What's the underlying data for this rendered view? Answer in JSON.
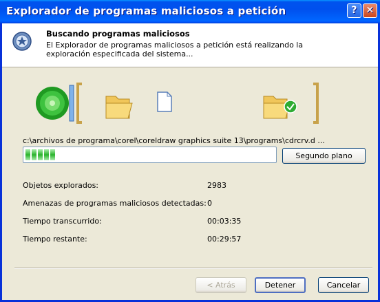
{
  "window": {
    "title": "Explorador de programas maliciosos a petición",
    "help_label": "?",
    "close_label": "✕"
  },
  "header": {
    "title": "Buscando programas maliciosos",
    "description": "El Explorador de programas maliciosos a petición está realizando la exploración especificada del sistema...",
    "icon": "scan-shield-icon"
  },
  "scan": {
    "current_path": "c:\\archivos de programa\\corel\\coreldraw graphics suite 13\\programs\\cdrcrv.d ...",
    "progress_chunks": 5,
    "background_button": "Segundo plano"
  },
  "stats": [
    {
      "label": "Objetos explorados:",
      "value": "2983"
    },
    {
      "label": "Amenazas de programas maliciosos detectadas:",
      "value": "0"
    },
    {
      "label": "Tiempo transcurrido:",
      "value": "00:03:35"
    },
    {
      "label": "Tiempo restante:",
      "value": "00:29:57"
    }
  ],
  "footer": {
    "back_label": "< Atrás",
    "stop_label": "Detener",
    "cancel_label": "Cancelar"
  },
  "colors": {
    "titlebar": "#0050ee",
    "progress": "#2ab32c",
    "accent_bracket": "#c8a24a"
  }
}
